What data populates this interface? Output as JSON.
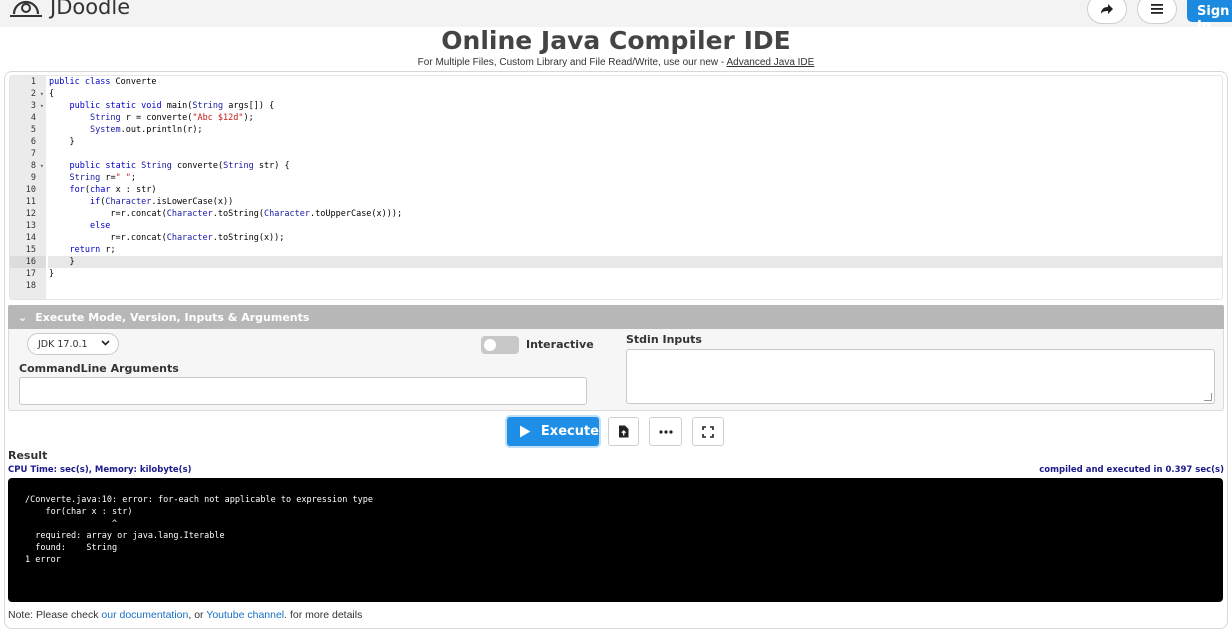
{
  "header": {
    "logo_text": "JDoodle",
    "signin_label": "Sign In"
  },
  "page": {
    "title": "Online Java Compiler IDE",
    "subtitle_prefix": "For Multiple Files, Custom Library and File Read/Write, use our new - ",
    "subtitle_link": "Advanced Java IDE"
  },
  "editor": {
    "active_line": 16,
    "lines": [
      {
        "n": "1",
        "fold": "",
        "html": "<span class='kw'>public</span> <span class='kw'>class</span> Converte"
      },
      {
        "n": "2",
        "fold": "▾",
        "html": "{"
      },
      {
        "n": "3",
        "fold": "▾",
        "html": "    <span class='kw'>public</span> <span class='kw'>static</span> <span class='kw'>void</span> main(<span class='ty'>String</span> args[]) {"
      },
      {
        "n": "4",
        "fold": "",
        "html": "        <span class='ty'>String</span> r = converte(<span class='str'>\"Abc $12d\"</span>);"
      },
      {
        "n": "5",
        "fold": "",
        "html": "        <span class='ty'>System</span>.out.println(r);"
      },
      {
        "n": "6",
        "fold": "",
        "html": "    }"
      },
      {
        "n": "7",
        "fold": "",
        "html": ""
      },
      {
        "n": "8",
        "fold": "▾",
        "html": "    <span class='kw'>public</span> <span class='kw'>static</span> <span class='ty'>String</span> converte(<span class='ty'>String</span> str) {"
      },
      {
        "n": "9",
        "fold": "",
        "html": "    <span class='ty'>String</span> r=<span class='str'>\" \"</span>;"
      },
      {
        "n": "10",
        "fold": "",
        "html": "    <span class='kw'>for</span>(<span class='kw'>char</span> x : str)"
      },
      {
        "n": "11",
        "fold": "",
        "html": "        <span class='kw'>if</span>(<span class='ty'>Character</span>.isLowerCase(x))"
      },
      {
        "n": "12",
        "fold": "",
        "html": "            r=r.concat(<span class='ty'>Character</span>.toString(<span class='ty'>Character</span>.toUpperCase(x)));"
      },
      {
        "n": "13",
        "fold": "",
        "html": "        <span class='kw'>else</span>"
      },
      {
        "n": "14",
        "fold": "",
        "html": "            r=r.concat(<span class='ty'>Character</span>.toString(x));"
      },
      {
        "n": "15",
        "fold": "",
        "html": "    <span class='kw'>return</span> r;"
      },
      {
        "n": "16",
        "fold": "",
        "html": "    }"
      },
      {
        "n": "17",
        "fold": "",
        "html": "}"
      },
      {
        "n": "18",
        "fold": "",
        "html": ""
      }
    ]
  },
  "options": {
    "section_title": "Execute Mode, Version, Inputs & Arguments",
    "jdk_selected": "JDK 17.0.1",
    "interactive_label": "Interactive",
    "interactive_on": false,
    "cmdline_label": "CommandLine Arguments",
    "cmdline_value": "",
    "stdin_label": "Stdin Inputs",
    "stdin_value": ""
  },
  "actions": {
    "execute_label": "Execute"
  },
  "result": {
    "label": "Result",
    "cpu_text": "CPU Time: sec(s), Memory: kilobyte(s)",
    "compiled_text": "compiled and executed in 0.397 sec(s)",
    "output_lines": [
      "/Converte.java:10: error: for-each not applicable to expression type",
      "    for(char x : str)",
      "                 ^",
      "  required: array or java.lang.Iterable",
      "  found:    String",
      "1 error"
    ]
  },
  "footer": {
    "note_prefix": "Note: Please check ",
    "doc_link": "our documentation",
    "middle": ", or ",
    "yt_link": "Youtube channel",
    "suffix": ". for more details"
  }
}
